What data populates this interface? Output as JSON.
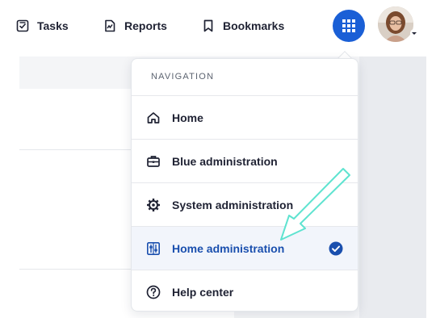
{
  "topbar": {
    "tasks_label": "Tasks",
    "reports_label": "Reports",
    "bookmarks_label": "Bookmarks"
  },
  "dropdown": {
    "header": "NAVIGATION",
    "items": [
      {
        "label": "Home",
        "icon": "home-icon"
      },
      {
        "label": "Blue administration",
        "icon": "briefcase-icon"
      },
      {
        "label": "System administration",
        "icon": "gear-icon"
      },
      {
        "label": "Home administration",
        "icon": "sliders-icon",
        "selected": true
      },
      {
        "label": "Help center",
        "icon": "question-icon"
      }
    ]
  },
  "colors": {
    "accent": "#1a5fd6",
    "selected_text": "#1a4fae",
    "annotation_arrow": "#5fe3d0"
  }
}
